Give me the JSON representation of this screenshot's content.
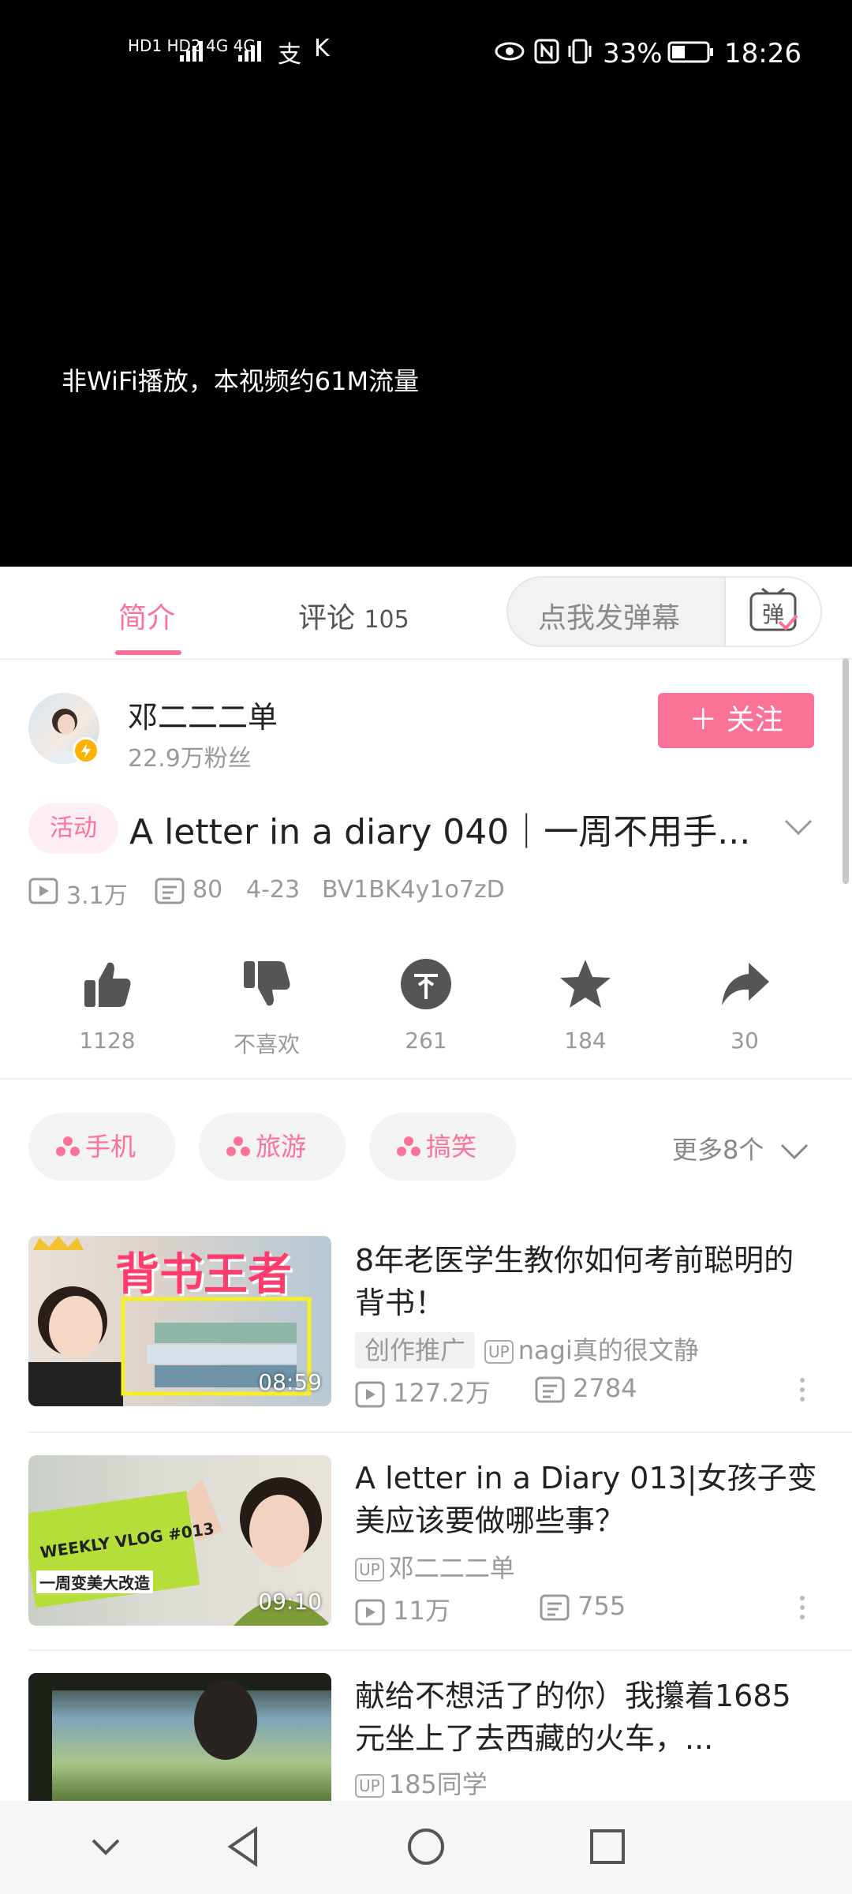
{
  "status_bar": {
    "network": "HD1 HD2 4G 4G",
    "battery": "33%",
    "time": "18:26"
  },
  "video": {
    "notice": "非WiFi播放，本视频约61M流量"
  },
  "tabs": {
    "intro": "简介",
    "comments": "评论",
    "comments_count": "105",
    "danmaku_placeholder": "点我发弹幕",
    "danmaku_icon_text": "弹"
  },
  "uploader": {
    "name": "邓二二二单",
    "fans": "22.9万粉丝",
    "follow_label": "＋ 关注"
  },
  "video_info": {
    "tag": "活动",
    "title": "A letter in a diary 040｜一周不用手...",
    "views": "3.1万",
    "danmaku_count": "80",
    "date": "4-23",
    "bvid": "BV1BK4y1o7zD"
  },
  "actions": [
    {
      "name": "like",
      "label": "1128"
    },
    {
      "name": "dislike",
      "label": "不喜欢"
    },
    {
      "name": "coin",
      "label": "261"
    },
    {
      "name": "favorite",
      "label": "184"
    },
    {
      "name": "share",
      "label": "30"
    }
  ],
  "tags": [
    "手机",
    "旅游",
    "搞笑"
  ],
  "more_tags": "更多8个",
  "related": [
    {
      "title": "8年老医学生教你如何考前聪明的背书！",
      "promo": "创作推广",
      "up": "nagi真的很文静",
      "views": "127.2万",
      "danmaku": "2784",
      "duration": "08:59",
      "thumb_text": "背书王者"
    },
    {
      "title": "A letter in a Diary 013|女孩子变美应该要做哪些事？",
      "up": "邓二二二单",
      "views": "11万",
      "danmaku": "755",
      "duration": "09:10",
      "thumb_text": "WEEKLY VLOG #013",
      "thumb_sub": "一周变美大改造"
    },
    {
      "title": "献给不想活了的你）我攥着1685元坐上了去西藏的火车，...",
      "up": "185同学"
    }
  ],
  "colors": {
    "accent": "#fb7299"
  }
}
